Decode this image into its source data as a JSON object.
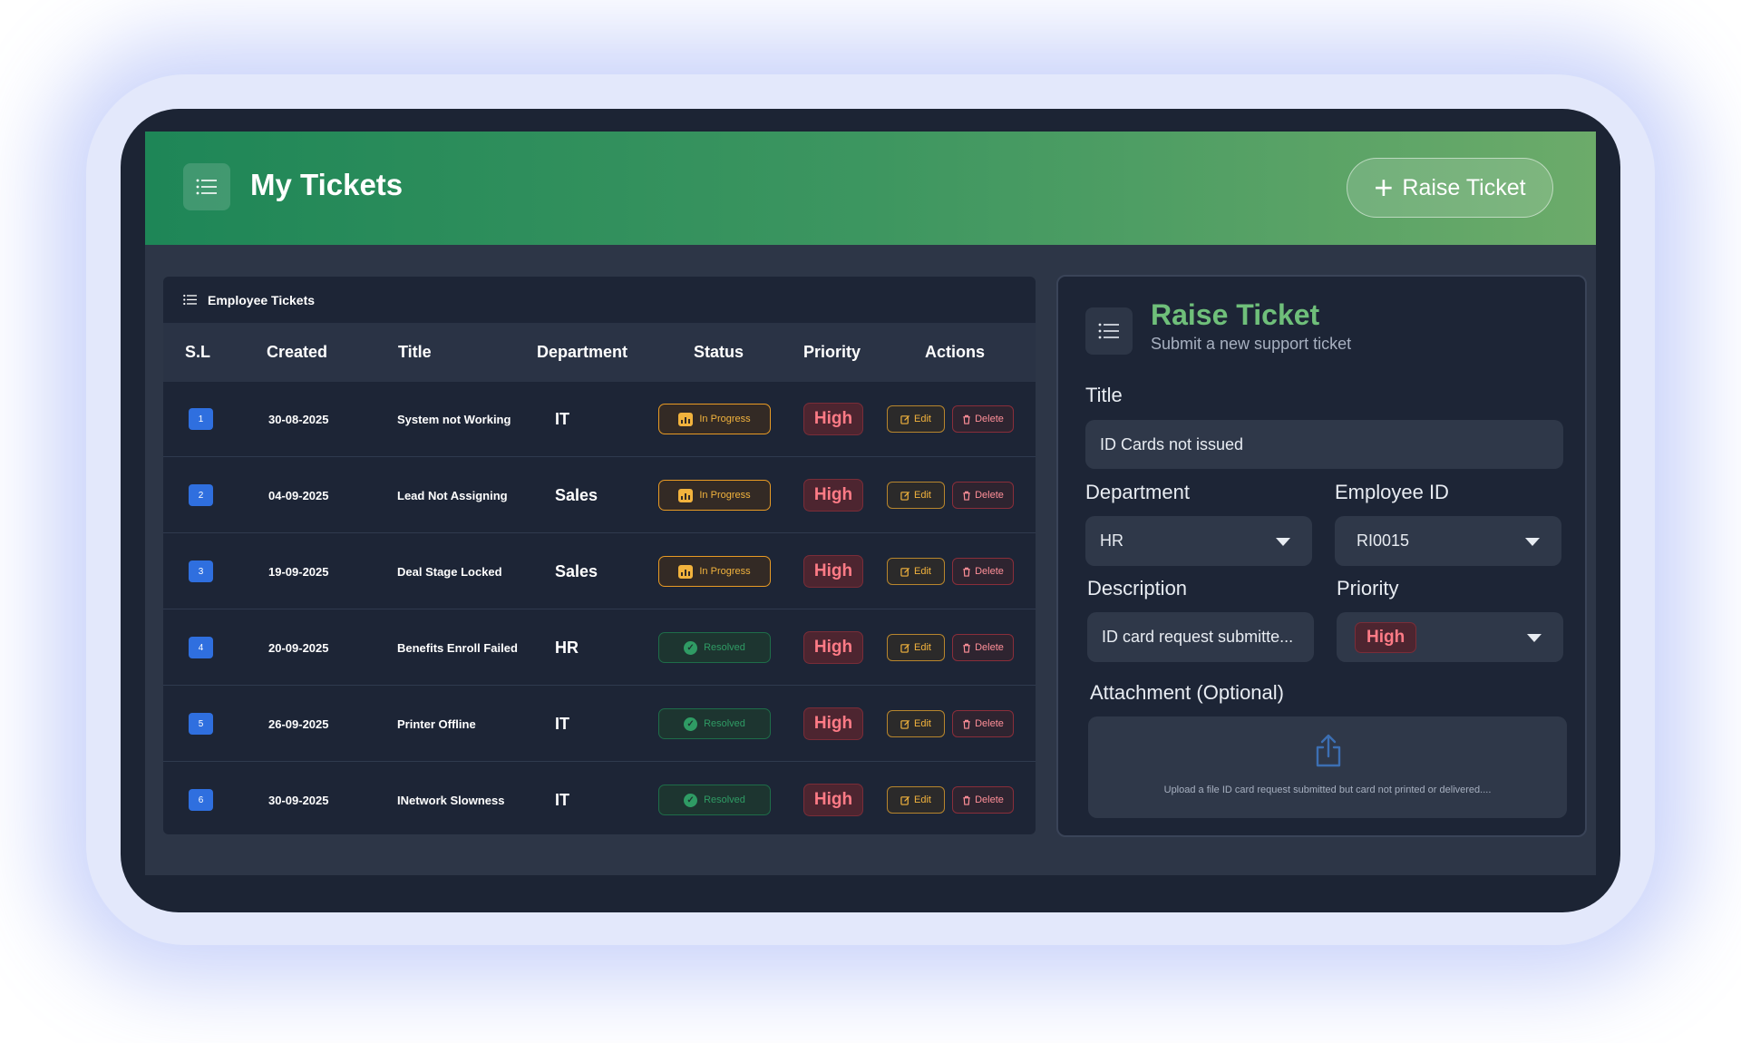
{
  "header": {
    "title": "My Tickets",
    "raise_button": "Raise Ticket"
  },
  "tickets_panel": {
    "title": "Employee Tickets",
    "columns": [
      "S.L",
      "Created",
      "Title",
      "Department",
      "Status",
      "Priority",
      "Actions"
    ],
    "edit_label": "Edit",
    "delete_label": "Delete",
    "rows": [
      {
        "sl": "1",
        "created": "30-08-2025",
        "title": "System not Working",
        "department": "IT",
        "status": "In Progress",
        "priority": "High"
      },
      {
        "sl": "2",
        "created": "04-09-2025",
        "title": "Lead Not Assigning",
        "department": "Sales",
        "status": "In Progress",
        "priority": "High"
      },
      {
        "sl": "3",
        "created": "19-09-2025",
        "title": "Deal Stage Locked",
        "department": "Sales",
        "status": "In Progress",
        "priority": "High"
      },
      {
        "sl": "4",
        "created": "20-09-2025",
        "title": "Benefits Enroll Failed",
        "department": "HR",
        "status": "Resolved",
        "priority": "High"
      },
      {
        "sl": "5",
        "created": "26-09-2025",
        "title": "Printer Offline",
        "department": "IT",
        "status": "Resolved",
        "priority": "High"
      },
      {
        "sl": "6",
        "created": "30-09-2025",
        "title": "INetwork Slowness",
        "department": "IT",
        "status": "Resolved",
        "priority": "High"
      }
    ]
  },
  "form": {
    "title": "Raise Ticket",
    "subtitle": "Submit a new support ticket",
    "title_label": "Title",
    "title_value": "ID Cards not issued",
    "department_label": "Department",
    "department_value": "HR",
    "employee_id_label": "Employee ID",
    "employee_id_value": "RI0015",
    "description_label": "Description",
    "description_value": "ID card request submitte...",
    "priority_label": "Priority",
    "priority_value": "High",
    "attachment_label": "Attachment (Optional)",
    "attachment_hint": "Upload a file ID card request submitted but card not printed or delivered...."
  },
  "colors": {
    "header_gradient_start": "#1e8657",
    "header_gradient_end": "#6cab6a",
    "in_progress": "#f2b33d",
    "resolved": "#2f9b64",
    "priority_high": "#ff7b86",
    "sl_badge": "#2f6fdf"
  },
  "icons": {
    "menu": "list-icon",
    "raise": "plus-icon",
    "edit": "edit-icon",
    "delete": "trash-icon",
    "upload": "upload-icon"
  }
}
